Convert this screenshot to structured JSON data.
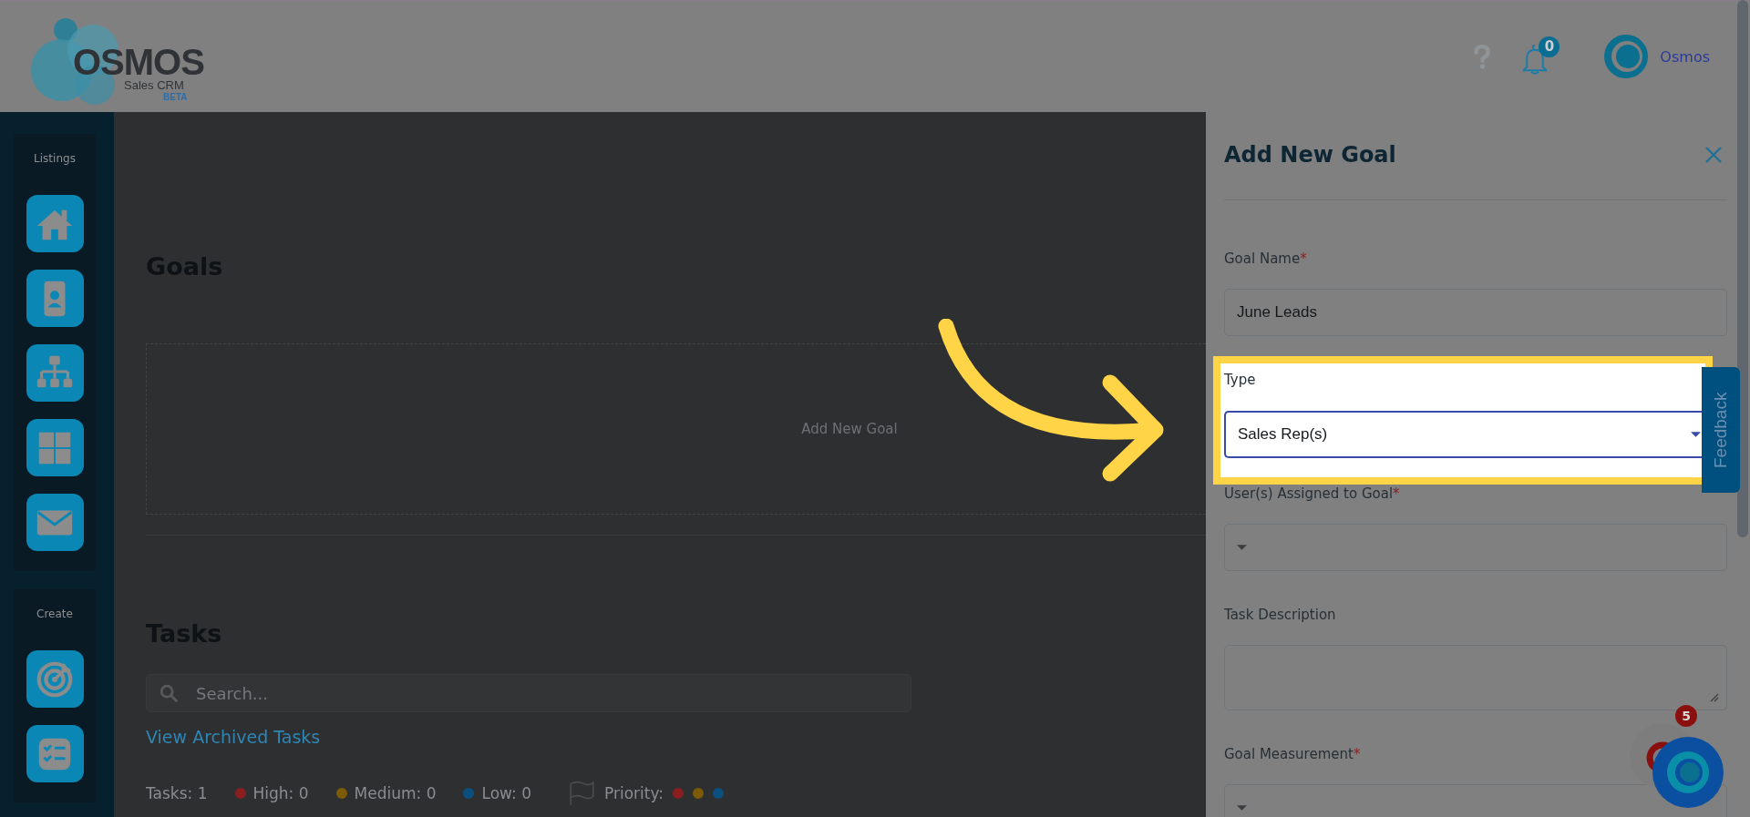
{
  "header": {
    "logo": {
      "wordmark": "OSMOS",
      "subtitle": "Sales CRM",
      "badge": "BETA"
    },
    "notifications": {
      "count": "0"
    },
    "user": {
      "name": "Osmos"
    }
  },
  "sidebar": {
    "sections": [
      {
        "title": "Listings",
        "items": [
          {
            "kind": "home"
          },
          {
            "kind": "contact"
          },
          {
            "kind": "hierarchy"
          },
          {
            "kind": "grid"
          },
          {
            "kind": "mail"
          }
        ]
      },
      {
        "title": "Create",
        "items": [
          {
            "kind": "target"
          },
          {
            "kind": "checklist"
          }
        ]
      }
    ]
  },
  "goals": {
    "title": "Goals",
    "empty_label": "Add New Goal"
  },
  "tasks": {
    "title": "Tasks",
    "search": {
      "placeholder": "Search..."
    },
    "archived_link": "View Archived Tasks",
    "summary": {
      "total": "Tasks: 1",
      "counts": [
        {
          "label": "High: 0",
          "color": "#8a1f1f"
        },
        {
          "label": "Medium: 0",
          "color": "#7d5a06"
        },
        {
          "label": "Low: 0",
          "color": "#0b4f7e"
        }
      ],
      "priority": {
        "label": "Priority:",
        "dots": [
          {
            "color": "#8a1f1f"
          },
          {
            "color": "#7d5a06"
          },
          {
            "color": "#0b4f7e"
          }
        ]
      }
    }
  },
  "panel": {
    "title": "Add New Goal",
    "fields": [
      {
        "kind": "text",
        "label": "Goal Name",
        "required_mark": "*",
        "value": "June Leads",
        "highlighted": false
      },
      {
        "kind": "select",
        "label": "Type",
        "value": "Sales Rep(s)",
        "highlighted": true
      },
      {
        "kind": "select",
        "label": "User(s) Assigned to Goal",
        "required_mark": "*",
        "highlighted": false
      },
      {
        "kind": "textarea",
        "label": "Task Description",
        "highlighted": false
      },
      {
        "kind": "select",
        "label": "Goal Measurement",
        "required_mark": "*",
        "highlighted": false
      }
    ]
  },
  "feedback_tab": "Feedback",
  "chat": {
    "badge": "5"
  }
}
